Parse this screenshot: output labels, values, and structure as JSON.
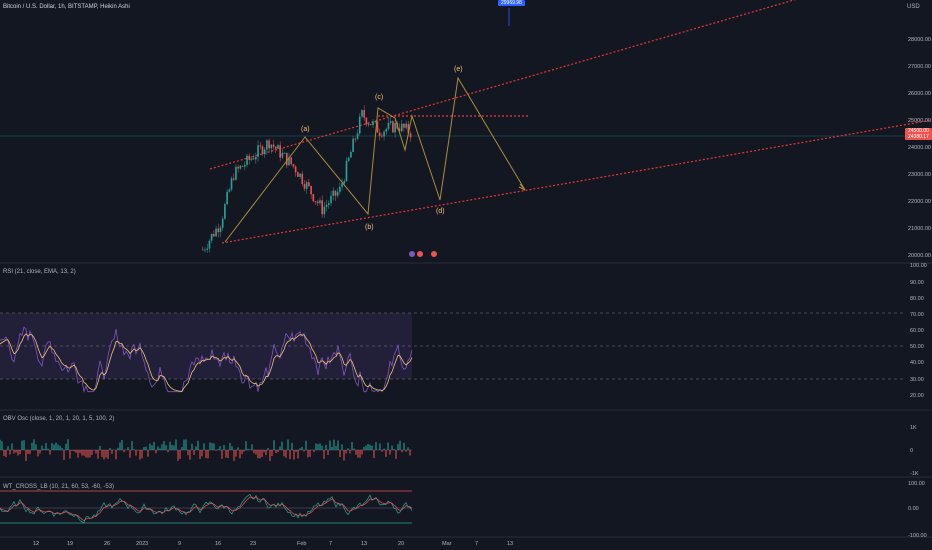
{
  "header": {
    "title": "Bitcoin / U.S. Dollar, 1h, BITSTAMP, Heikin Ashi",
    "currency": "USD"
  },
  "price_axis": {
    "ticks": [
      "28000.00",
      "27000.00",
      "26000.00",
      "25000.00",
      "24000.00",
      "23000.00",
      "22000.00",
      "21000.00",
      "20000.00"
    ],
    "current_price": "24500.00",
    "current_price_sub": "24380.17",
    "top_tag": "29969.98"
  },
  "waves": {
    "a": "(a)",
    "b": "(b)",
    "c": "(c)",
    "d": "(d)",
    "e": "(e)"
  },
  "rsi": {
    "label": "RSI (21, close, EMA, 13, 2)",
    "ticks": [
      "100.00",
      "90.00",
      "80.00",
      "70.00",
      "60.00",
      "50.00",
      "40.00",
      "30.00",
      "20.00"
    ]
  },
  "obv": {
    "label": "OBV Osc (close, 1, 20, 1, 20, 1, 5, 100, 2)",
    "ticks": [
      "1K",
      "0",
      "-1K"
    ]
  },
  "wt": {
    "label": "WT_CROSS_LB (10, 21, 60, 53, -60, -53)",
    "ticks": [
      "100.00",
      "0.00",
      "-100.00"
    ]
  },
  "time_axis": [
    "12",
    "19",
    "26",
    "2023",
    "9",
    "16",
    "23",
    "Feb",
    "7",
    "13",
    "20",
    "Mar",
    "7",
    "13"
  ],
  "colors": {
    "background": "#131722",
    "up": "#26a69a",
    "down": "#ef5350",
    "wave": "#a88d3a",
    "trendline": "#e53935",
    "rsi": "#7e57c2",
    "rsi_ma": "#f5c26b"
  }
}
